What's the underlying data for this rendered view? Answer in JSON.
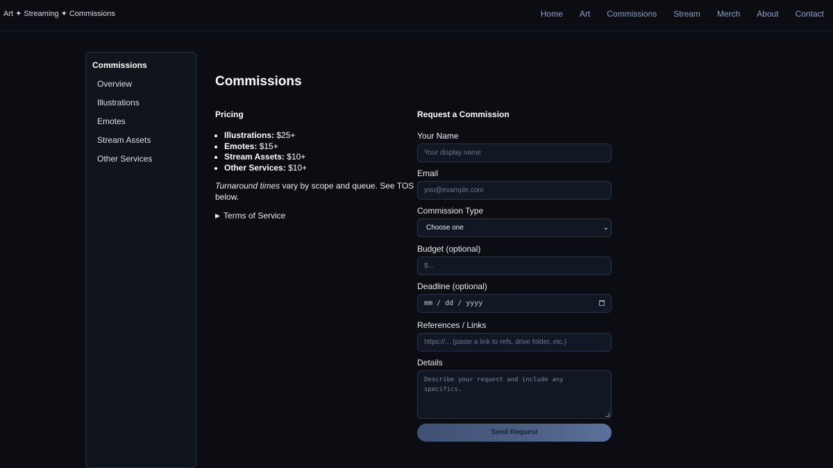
{
  "header": {
    "brand": "Art ✦ Streaming ✦ Commissions",
    "nav": [
      "Home",
      "Art",
      "Commissions",
      "Stream",
      "Merch",
      "About",
      "Contact"
    ]
  },
  "sidebar": {
    "title": "Commissions",
    "items": [
      "Overview",
      "Illustrations",
      "Emotes",
      "Stream Assets",
      "Other Services"
    ]
  },
  "main": {
    "title": "Commissions",
    "pricing": {
      "heading": "Pricing",
      "items": [
        {
          "name": "Illustrations:",
          "price": "$25+"
        },
        {
          "name": "Emotes:",
          "price": "$15+"
        },
        {
          "name": "Stream Assets:",
          "price": "$10+"
        },
        {
          "name": "Other Services:",
          "price": "$10+"
        }
      ],
      "turnaround_em": "Turnaround times",
      "turnaround_rest": " vary by scope and queue. See TOS below.",
      "tos_label": "Terms of Service"
    },
    "form": {
      "heading": "Request a Commission",
      "name_label": "Your Name",
      "name_placeholder": "Your display name",
      "email_label": "Email",
      "email_placeholder": "you@example.com",
      "type_label": "Commission Type",
      "type_selected": "Choose one",
      "budget_label": "Budget (optional)",
      "budget_placeholder": "$...",
      "deadline_label": "Deadline (optional)",
      "deadline_placeholder": "mm / dd / yyyy",
      "refs_label": "References / Links",
      "refs_placeholder": "https://... (paste a link to refs, drive folder, etc.)",
      "details_label": "Details",
      "details_placeholder": "Describe your request and include any specifics.",
      "submit_label": "Send Request"
    }
  }
}
